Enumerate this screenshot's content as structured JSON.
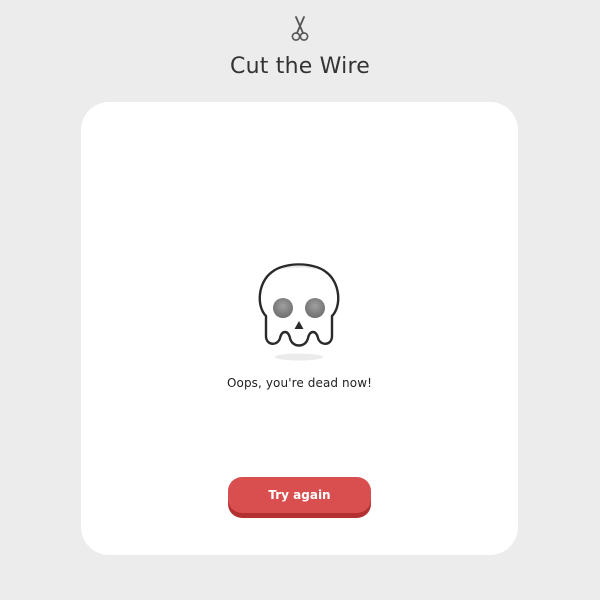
{
  "header": {
    "icon": "scissors-icon",
    "title": "Cut the Wire"
  },
  "game_over": {
    "icon": "skull-icon",
    "message": "Oops, you're dead now!",
    "retry_label": "Try again"
  },
  "colors": {
    "background": "#ececec",
    "card": "#ffffff",
    "button": "#d94f4f",
    "button_shadow": "#b43131",
    "text": "#333333"
  }
}
